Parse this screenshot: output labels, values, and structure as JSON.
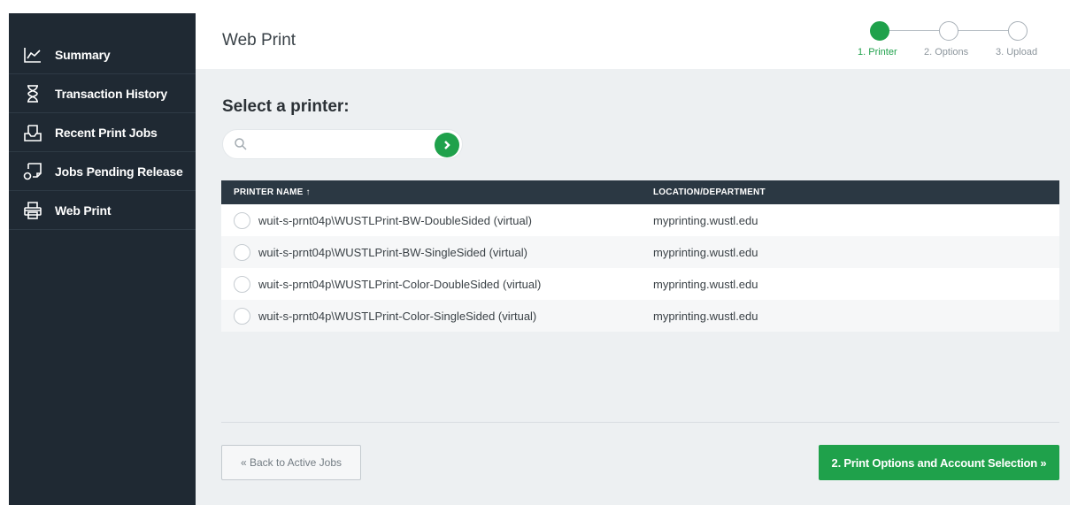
{
  "sidebar": {
    "items": [
      {
        "label": "Summary",
        "icon": "chart-line-icon"
      },
      {
        "label": "Transaction History",
        "icon": "hourglass-icon"
      },
      {
        "label": "Recent Print Jobs",
        "icon": "print-tray-icon"
      },
      {
        "label": "Jobs Pending Release",
        "icon": "pending-release-icon"
      },
      {
        "label": "Web Print",
        "icon": "printer-icon"
      }
    ]
  },
  "header": {
    "title": "Web Print",
    "steps": [
      {
        "label": "1. Printer",
        "active": true
      },
      {
        "label": "2. Options",
        "active": false
      },
      {
        "label": "3. Upload",
        "active": false
      }
    ]
  },
  "main": {
    "section_title": "Select a printer:",
    "search": {
      "value": "",
      "placeholder": ""
    },
    "table": {
      "headers": [
        "PRINTER NAME ↑",
        "LOCATION/DEPARTMENT"
      ],
      "rows": [
        {
          "name": "wuit-s-prnt04p\\WUSTLPrint-BW-DoubleSided (virtual)",
          "location": "myprinting.wustl.edu"
        },
        {
          "name": "wuit-s-prnt04p\\WUSTLPrint-BW-SingleSided (virtual)",
          "location": "myprinting.wustl.edu"
        },
        {
          "name": "wuit-s-prnt04p\\WUSTLPrint-Color-DoubleSided (virtual)",
          "location": "myprinting.wustl.edu"
        },
        {
          "name": "wuit-s-prnt04p\\WUSTLPrint-Color-SingleSided (virtual)",
          "location": "myprinting.wustl.edu"
        }
      ]
    },
    "back_button": "« Back to Active Jobs",
    "next_button": "2. Print Options and Account Selection »"
  },
  "colors": {
    "accent": "#1fa14b",
    "sidebar_bg": "#1f2933",
    "table_header_bg": "#2b3843",
    "main_bg": "#edf0f2"
  }
}
